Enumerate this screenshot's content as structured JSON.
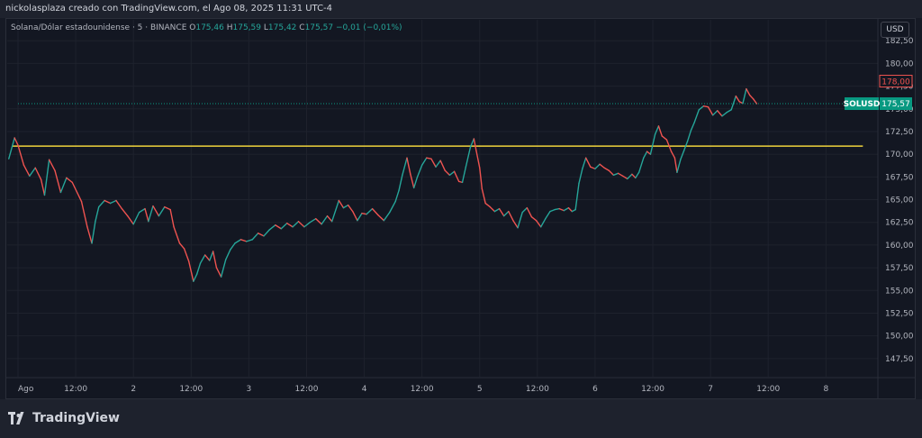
{
  "header": {
    "text": "nickolasplaza creado con TradingView.com, el Ago 08, 2025 11:31 UTC-4"
  },
  "legend": {
    "symbol": "Solana/Dólar estadounidense · 5 · BINANCE",
    "o_label": "O",
    "o_value": "175,46",
    "h_label": "H",
    "h_value": "175,59",
    "l_label": "L",
    "l_value": "175,42",
    "c_label": "C",
    "c_value": "175,57",
    "change": "−0,01 (−0,01%)"
  },
  "currency": "USD",
  "footer": {
    "brand": "TradingView",
    "logo_icon": "tradingview-logo-icon"
  },
  "colors": {
    "up": "#26a69a",
    "down": "#ef5350",
    "level": "#f0d33c",
    "price_tag": "#089981"
  },
  "chart_data": {
    "type": "line",
    "title": "",
    "symbol_label": "SOLUSD",
    "last_price": "175,57",
    "high_marker": "178,00",
    "ylim": [
      145.5,
      185
    ],
    "xlim": [
      0,
      7.45
    ],
    "y_ticks": [
      {
        "v": 147.5,
        "t": "147,50"
      },
      {
        "v": 150,
        "t": "150,00"
      },
      {
        "v": 152.5,
        "t": "152,50"
      },
      {
        "v": 155,
        "t": "155,00"
      },
      {
        "v": 157.5,
        "t": "157,50"
      },
      {
        "v": 160,
        "t": "160,00"
      },
      {
        "v": 162.5,
        "t": "162,50"
      },
      {
        "v": 165,
        "t": "165,00"
      },
      {
        "v": 167.5,
        "t": "167,50"
      },
      {
        "v": 170,
        "t": "170,00"
      },
      {
        "v": 172.5,
        "t": "172,50"
      },
      {
        "v": 175,
        "t": "175,00"
      },
      {
        "v": 177.5,
        "t": "177,50"
      },
      {
        "v": 180,
        "t": "180,00"
      },
      {
        "v": 182.5,
        "t": "182,50"
      }
    ],
    "x_ticks": [
      {
        "v": 0,
        "t": "Ago"
      },
      {
        "v": 0.5,
        "t": "12:00"
      },
      {
        "v": 1,
        "t": "2"
      },
      {
        "v": 1.5,
        "t": "12:00"
      },
      {
        "v": 2,
        "t": "3"
      },
      {
        "v": 2.5,
        "t": "12:00"
      },
      {
        "v": 3,
        "t": "4"
      },
      {
        "v": 3.5,
        "t": "12:00"
      },
      {
        "v": 4,
        "t": "5"
      },
      {
        "v": 4.5,
        "t": "12:00"
      },
      {
        "v": 5,
        "t": "6"
      },
      {
        "v": 5.5,
        "t": "12:00"
      },
      {
        "v": 6,
        "t": "7"
      },
      {
        "v": 6.5,
        "t": "12:00"
      },
      {
        "v": 7,
        "t": "8"
      }
    ],
    "level_line": {
      "price": 170.9,
      "x_start": -0.05,
      "x_end": 7.32
    },
    "series": [
      {
        "values": [
          [
            -0.08,
            169.5
          ],
          [
            -0.03,
            171.8
          ],
          [
            0.0,
            171.0
          ],
          [
            0.05,
            168.8
          ],
          [
            0.1,
            167.6
          ],
          [
            0.15,
            168.5
          ],
          [
            0.2,
            167.2
          ],
          [
            0.23,
            165.5
          ],
          [
            0.27,
            169.4
          ],
          [
            0.32,
            168.2
          ],
          [
            0.37,
            165.8
          ],
          [
            0.42,
            167.4
          ],
          [
            0.47,
            166.9
          ],
          [
            0.55,
            164.8
          ],
          [
            0.6,
            162.0
          ],
          [
            0.64,
            160.2
          ],
          [
            0.67,
            162.6
          ],
          [
            0.7,
            164.2
          ],
          [
            0.75,
            164.9
          ],
          [
            0.8,
            164.6
          ],
          [
            0.85,
            164.9
          ],
          [
            0.9,
            164.0
          ],
          [
            0.95,
            163.2
          ],
          [
            1.0,
            162.3
          ],
          [
            1.05,
            163.6
          ],
          [
            1.1,
            164.0
          ],
          [
            1.13,
            162.6
          ],
          [
            1.17,
            164.3
          ],
          [
            1.22,
            163.2
          ],
          [
            1.27,
            164.2
          ],
          [
            1.32,
            163.9
          ],
          [
            1.35,
            162.0
          ],
          [
            1.4,
            160.2
          ],
          [
            1.44,
            159.6
          ],
          [
            1.48,
            158.2
          ],
          [
            1.52,
            156.0
          ],
          [
            1.55,
            156.8
          ],
          [
            1.58,
            158.0
          ],
          [
            1.62,
            158.9
          ],
          [
            1.66,
            158.3
          ],
          [
            1.69,
            159.3
          ],
          [
            1.72,
            157.5
          ],
          [
            1.76,
            156.5
          ],
          [
            1.8,
            158.4
          ],
          [
            1.84,
            159.5
          ],
          [
            1.88,
            160.2
          ],
          [
            1.93,
            160.6
          ],
          [
            1.98,
            160.4
          ],
          [
            2.03,
            160.6
          ],
          [
            2.08,
            161.3
          ],
          [
            2.13,
            161.0
          ],
          [
            2.18,
            161.7
          ],
          [
            2.23,
            162.2
          ],
          [
            2.28,
            161.8
          ],
          [
            2.33,
            162.4
          ],
          [
            2.38,
            162.0
          ],
          [
            2.43,
            162.6
          ],
          [
            2.48,
            162.0
          ],
          [
            2.53,
            162.5
          ],
          [
            2.58,
            162.9
          ],
          [
            2.63,
            162.3
          ],
          [
            2.68,
            163.2
          ],
          [
            2.72,
            162.6
          ],
          [
            2.78,
            164.9
          ],
          [
            2.82,
            164.1
          ],
          [
            2.86,
            164.4
          ],
          [
            2.9,
            163.7
          ],
          [
            2.94,
            162.7
          ],
          [
            2.98,
            163.5
          ],
          [
            3.02,
            163.4
          ],
          [
            3.07,
            164.0
          ],
          [
            3.12,
            163.3
          ],
          [
            3.17,
            162.7
          ],
          [
            3.22,
            163.6
          ],
          [
            3.27,
            164.8
          ],
          [
            3.3,
            166.0
          ],
          [
            3.33,
            167.7
          ],
          [
            3.37,
            169.6
          ],
          [
            3.4,
            167.8
          ],
          [
            3.43,
            166.3
          ],
          [
            3.46,
            167.5
          ],
          [
            3.5,
            168.8
          ],
          [
            3.54,
            169.6
          ],
          [
            3.58,
            169.5
          ],
          [
            3.62,
            168.6
          ],
          [
            3.66,
            169.3
          ],
          [
            3.7,
            168.2
          ],
          [
            3.74,
            167.7
          ],
          [
            3.78,
            168.1
          ],
          [
            3.82,
            167.0
          ],
          [
            3.85,
            166.9
          ],
          [
            3.88,
            168.6
          ],
          [
            3.92,
            170.8
          ],
          [
            3.95,
            171.7
          ],
          [
            3.97,
            170.4
          ],
          [
            4.0,
            168.5
          ],
          [
            4.02,
            166.2
          ],
          [
            4.05,
            164.6
          ],
          [
            4.09,
            164.2
          ],
          [
            4.13,
            163.7
          ],
          [
            4.17,
            164.0
          ],
          [
            4.21,
            163.2
          ],
          [
            4.25,
            163.7
          ],
          [
            4.29,
            162.7
          ],
          [
            4.33,
            161.9
          ],
          [
            4.37,
            163.6
          ],
          [
            4.41,
            164.1
          ],
          [
            4.45,
            163.1
          ],
          [
            4.49,
            162.7
          ],
          [
            4.53,
            162.0
          ],
          [
            4.57,
            162.9
          ],
          [
            4.61,
            163.7
          ],
          [
            4.65,
            163.9
          ],
          [
            4.69,
            164.0
          ],
          [
            4.73,
            163.8
          ],
          [
            4.77,
            164.1
          ],
          [
            4.8,
            163.7
          ],
          [
            4.83,
            163.9
          ],
          [
            4.86,
            166.8
          ],
          [
            4.89,
            168.4
          ],
          [
            4.92,
            169.6
          ],
          [
            4.96,
            168.6
          ],
          [
            5.0,
            168.4
          ],
          [
            5.04,
            168.9
          ],
          [
            5.08,
            168.5
          ],
          [
            5.12,
            168.2
          ],
          [
            5.16,
            167.7
          ],
          [
            5.2,
            167.9
          ],
          [
            5.24,
            167.6
          ],
          [
            5.28,
            167.3
          ],
          [
            5.32,
            167.8
          ],
          [
            5.35,
            167.4
          ],
          [
            5.38,
            168.0
          ],
          [
            5.42,
            169.6
          ],
          [
            5.45,
            170.3
          ],
          [
            5.48,
            170.0
          ],
          [
            5.52,
            172.2
          ],
          [
            5.55,
            173.1
          ],
          [
            5.58,
            172.0
          ],
          [
            5.62,
            171.6
          ],
          [
            5.66,
            170.3
          ],
          [
            5.69,
            169.6
          ],
          [
            5.71,
            168.0
          ],
          [
            5.74,
            169.4
          ],
          [
            5.77,
            170.4
          ],
          [
            5.8,
            171.4
          ],
          [
            5.83,
            172.6
          ],
          [
            5.86,
            173.5
          ],
          [
            5.9,
            174.9
          ],
          [
            5.94,
            175.3
          ],
          [
            5.98,
            175.2
          ],
          [
            6.02,
            174.3
          ],
          [
            6.06,
            174.8
          ],
          [
            6.1,
            174.2
          ],
          [
            6.14,
            174.6
          ],
          [
            6.18,
            174.9
          ],
          [
            6.22,
            176.4
          ],
          [
            6.25,
            175.8
          ],
          [
            6.28,
            175.6
          ],
          [
            6.31,
            177.2
          ],
          [
            6.34,
            176.5
          ],
          [
            6.37,
            176.1
          ],
          [
            6.4,
            175.57
          ]
        ]
      }
    ]
  }
}
